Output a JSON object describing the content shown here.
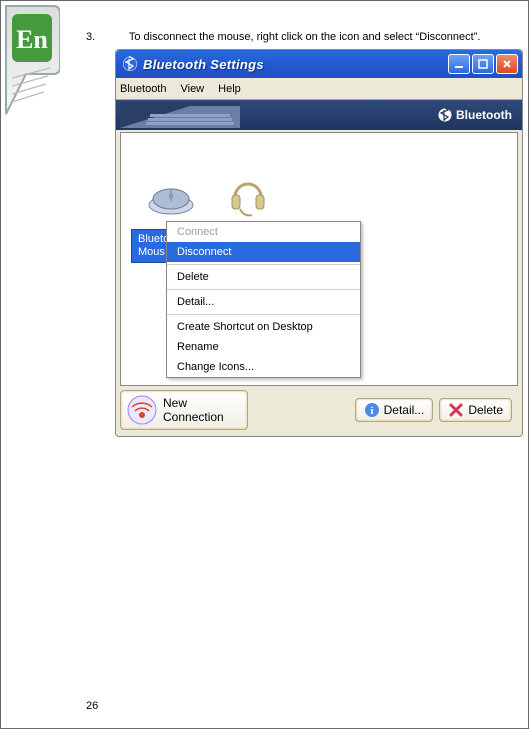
{
  "side_tab": {
    "label": "En"
  },
  "instruction": {
    "number": "3.",
    "text": "To disconnect the mouse, right click on the icon and select “Disconnect”."
  },
  "window": {
    "title": "Bluetooth Settings",
    "menu": {
      "item1": "Bluetooth",
      "item2": "View",
      "item3": "Help"
    },
    "banner": "Bluetooth",
    "device_label": {
      "line1": "Blueto",
      "line2": "Mous"
    },
    "context_menu": {
      "connect": "Connect",
      "disconnect": "Disconnect",
      "delete": "Delete",
      "detail": "Detail...",
      "shortcut": "Create Shortcut on Desktop",
      "rename": "Rename",
      "change_icons": "Change Icons..."
    },
    "buttons": {
      "new_connection": {
        "line1": "New",
        "line2": "Connection"
      },
      "detail": "Detail...",
      "delete": "Delete"
    }
  },
  "page_number": "26"
}
